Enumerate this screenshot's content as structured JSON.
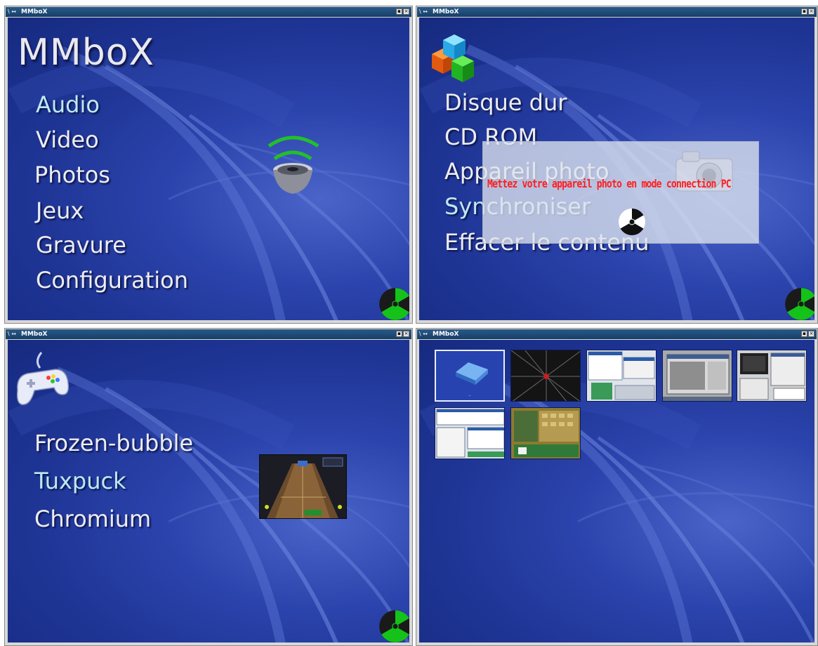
{
  "window_title": "MMboX",
  "titlebar_buttons": {
    "minimize": "▪",
    "close": "×"
  },
  "titlebar_menu_glyph": "\\ ↔",
  "panel1": {
    "app_title": "MMboX",
    "menu": [
      "Audio",
      "Video",
      "Photos",
      "Jeux",
      "Gravure",
      "Configuration"
    ],
    "selected": "Audio",
    "icon": "speaker-icon"
  },
  "panel2": {
    "menu": [
      "Disque dur",
      "CD ROM",
      "Appareil photo",
      "Synchroniser",
      "Effacer le contenu"
    ],
    "selected": "Synchroniser",
    "icon": "cubes-icon",
    "dialog": {
      "message": "Mettez votre appareil photo en mode connection PC",
      "icon": "radiation-spinner-icon"
    }
  },
  "panel3": {
    "menu": [
      "Frozen-bubble",
      "Tuxpuck",
      "Chromium"
    ],
    "selected": "Tuxpuck",
    "icon": "gamepad-icon"
  },
  "panel4": {
    "thumbnails": [
      {
        "name": "folder",
        "label": "..",
        "selected": true
      },
      {
        "name": "dark-star-screenshot"
      },
      {
        "name": "desktop-screenshot-1"
      },
      {
        "name": "desktop-screenshot-2"
      },
      {
        "name": "desktop-screenshot-3"
      },
      {
        "name": "desktop-screenshot-4"
      },
      {
        "name": "game-screenshot"
      }
    ]
  },
  "colors": {
    "background": "#1f3595",
    "selected_text": "#bde8f4",
    "text": "#ececf2",
    "dialog_text": "#ff1e1e",
    "logo_green": "#15c21a"
  }
}
